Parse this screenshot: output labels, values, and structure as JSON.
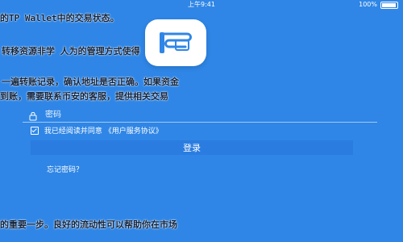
{
  "status_bar": {
    "time": "上午9:41",
    "battery": "100%"
  },
  "overlay_text": {
    "line1": "的TP  Wallet中的交易状态。",
    "line2": "转移资源非学  人为的管理方式使得",
    "line3": "一遍转账记录，确认地址是否正确。如果资金",
    "line4": "到账，需要联系币安的客服，提供相关交易",
    "line5": "的重要一步。良好的流动性可以帮助你在市场"
  },
  "login_form": {
    "password_placeholder": "密码",
    "agree_text": "我已经阅读并同意",
    "agree_link": "《用户服务协议》",
    "login_button": "登录",
    "forgot_password": "忘记密码？"
  },
  "icons": {
    "logo": "app-logo-icon",
    "lock": "lock-icon",
    "checkbox": "checkbox-checked-icon",
    "battery": "battery-icon"
  },
  "colors": {
    "background": "#2f86e6",
    "button": "#2a7ce0",
    "text": "#ffffff"
  }
}
